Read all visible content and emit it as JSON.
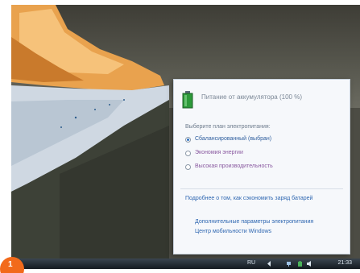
{
  "flyout": {
    "title": "Питание от аккумулятора (100 %)",
    "section_label": "Выберите план электропитания:",
    "plans": [
      {
        "label": "Сбалансированный (выбран)",
        "selected": true
      },
      {
        "label": "Экономия энергии",
        "selected": false
      },
      {
        "label": "Высокая производительность",
        "selected": false
      }
    ],
    "note": "Подробнее о том, как сэкономить заряд батарей",
    "links": [
      "Дополнительные параметры электропитания",
      "Центр мобильности Windows"
    ]
  },
  "taskbar": {
    "language": "RU",
    "time": "21:33"
  },
  "step_badge": "1",
  "colors": {
    "flyout_bg": "#f6f8fb",
    "link": "#2f67b1",
    "accent_orange": "#f26a1b",
    "battery_green": "#2d9a3a"
  }
}
